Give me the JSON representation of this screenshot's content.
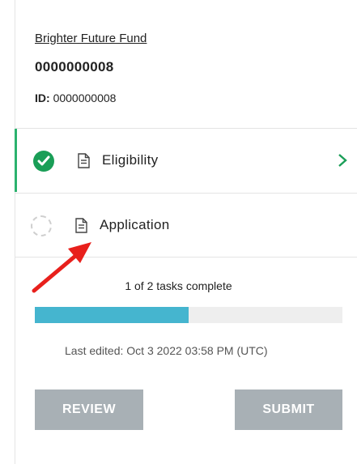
{
  "header": {
    "fund_name": "Brighter Future Fund",
    "application_title": "0000000008",
    "id_label": "ID:",
    "id_value": "0000000008"
  },
  "tasks": [
    {
      "label": "Eligibility",
      "status": "complete",
      "icon": "document-icon"
    },
    {
      "label": "Application",
      "status": "not-started",
      "icon": "document-icon"
    }
  ],
  "progress": {
    "text": "1 of 2 tasks complete",
    "completed": 1,
    "total": 2,
    "fraction": 0.5,
    "fill_color": "#45b5cf"
  },
  "last_edited": "Last edited: Oct 3 2022 03:58 PM (UTC)",
  "actions": {
    "review_label": "REVIEW",
    "submit_label": "SUBMIT"
  },
  "colors": {
    "complete_green": "#1a9e57",
    "active_border": "#2bb26e",
    "button_gray": "#a8b0b5",
    "annotation_red": "#e8201c"
  }
}
